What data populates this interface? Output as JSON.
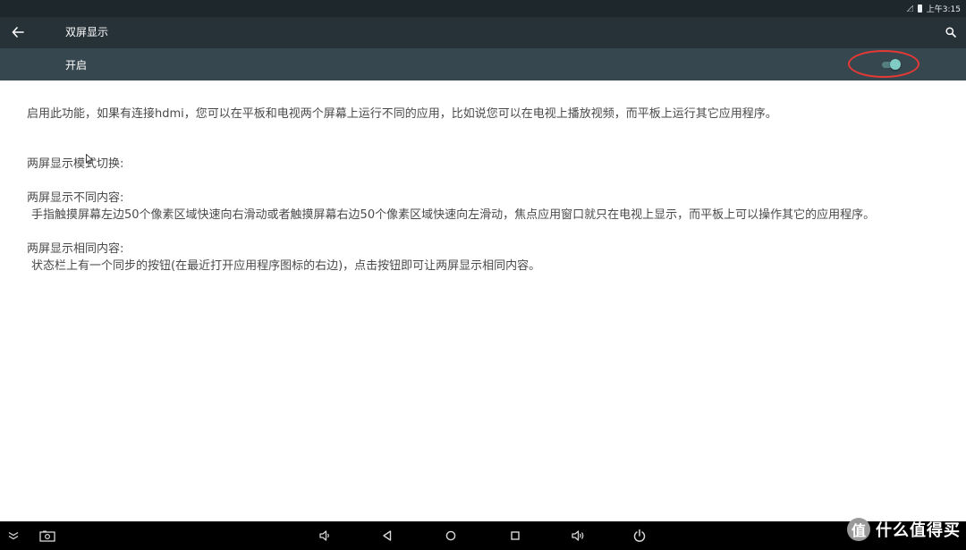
{
  "status_bar": {
    "time": "上午3:15",
    "icons": [
      "signal-icon",
      "battery-icon"
    ]
  },
  "toolbar": {
    "title": "双屏显示",
    "back_icon": "back-arrow-icon",
    "search_icon": "search-icon"
  },
  "switch_bar": {
    "label": "开启",
    "toggle_state": "on",
    "accent": "#80cbc4"
  },
  "content": {
    "intro": "启用此功能，如果有连接hdmi，您可以在平板和电视两个屏幕上运行不同的应用，比如说您可以在电视上播放视频，而平板上运行其它应用程序。",
    "mode_heading": "两屏显示模式切换:",
    "different_heading": "两屏显示不同内容:",
    "different_body": "手指触摸屏幕左边50个像素区域快速向右滑动或者触摸屏幕右边50个像素区域快速向左滑动，焦点应用窗口就只在电视上显示，而平板上可以操作其它的应用程序。",
    "same_heading": "两屏显示相同内容:",
    "same_body": "状态栏上有一个同步的按钮(在最近打开应用程序图标的右边)，点击按钮即可让两屏显示相同内容。"
  },
  "nav_bar": {
    "buttons": [
      "collapse-icon",
      "screenshot-icon",
      "volume-down-icon",
      "back-icon",
      "home-icon",
      "recents-icon",
      "volume-up-icon",
      "power-icon"
    ]
  },
  "watermark": {
    "badge": "值",
    "text": "什么值得买"
  },
  "colors": {
    "status_bar": "#1e282c",
    "toolbar": "#263238",
    "switch_bar": "#37474f",
    "annotation": "#e53935",
    "body_text": "#4a4a4a"
  }
}
